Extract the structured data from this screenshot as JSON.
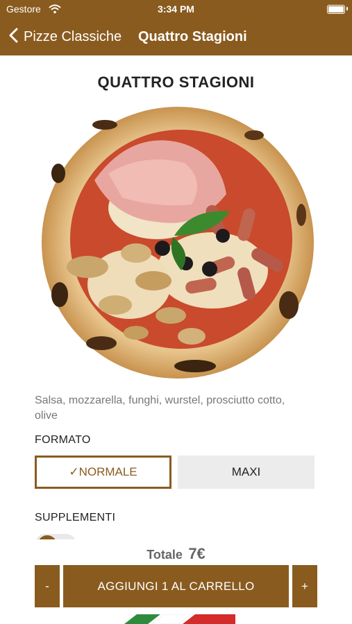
{
  "status": {
    "carrier": "Gestore",
    "time": "3:34 PM"
  },
  "nav": {
    "back_label": "Pizze Classiche",
    "title": "Quattro Stagioni"
  },
  "product": {
    "title": "QUATTRO STAGIONI",
    "description": "Salsa, mozzarella, funghi, wurstel, prosciutto cotto, olive"
  },
  "formato": {
    "label": "FORMATO",
    "options": [
      {
        "label": "✓NORMALE",
        "selected": true
      },
      {
        "label": "MAXI",
        "selected": false
      }
    ]
  },
  "supplementi": {
    "label": "SUPPLEMENTI"
  },
  "cart": {
    "total_label": "Totale",
    "total_value": "7€",
    "minus_label": "-",
    "add_label": "AGGIUNGI 1 AL CARRELLO",
    "plus_label": "+"
  },
  "colors": {
    "brand": "#8a5b1f",
    "unselected_bg": "#ececec"
  }
}
